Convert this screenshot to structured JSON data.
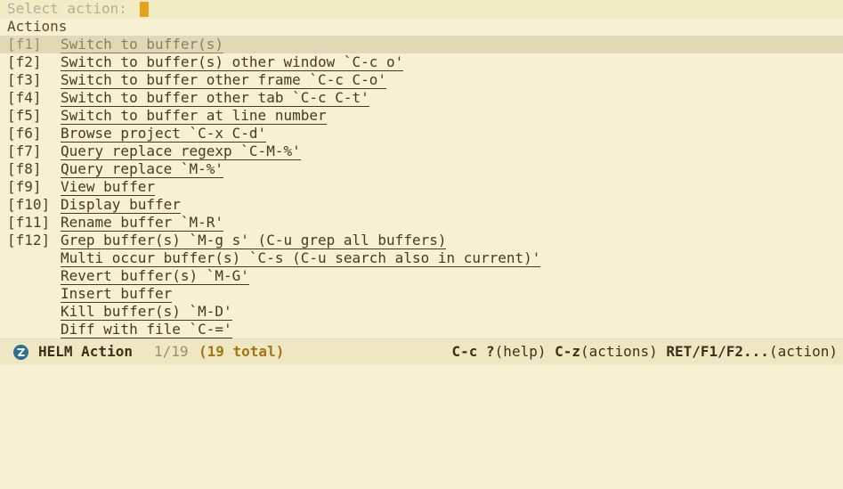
{
  "minibuffer": {
    "prompt": "Select action: "
  },
  "source_header": "Actions",
  "actions": [
    {
      "key": "[f1]",
      "label": "Switch to buffer(s)",
      "selected": true
    },
    {
      "key": "[f2]",
      "label": "Switch to buffer(s) other window `C-c o'"
    },
    {
      "key": "[f3]",
      "label": "Switch to buffer other frame `C-c C-o'"
    },
    {
      "key": "[f4]",
      "label": "Switch to buffer other tab `C-c C-t'"
    },
    {
      "key": "[f5]",
      "label": "Switch to buffer at line number"
    },
    {
      "key": "[f6]",
      "label": "Browse project `C-x C-d'"
    },
    {
      "key": "[f7]",
      "label": "Query replace regexp `C-M-%'"
    },
    {
      "key": "[f8]",
      "label": "Query replace `M-%'"
    },
    {
      "key": "[f9]",
      "label": "View buffer"
    },
    {
      "key": "[f10]",
      "label": "Display buffer"
    },
    {
      "key": "[f11]",
      "label": "Rename buffer `M-R'"
    },
    {
      "key": "[f12]",
      "label": "Grep buffer(s) `M-g s' (C-u grep all buffers)"
    },
    {
      "key": "",
      "label": "Multi occur buffer(s) `C-s (C-u search also in current)'"
    },
    {
      "key": "",
      "label": "Revert buffer(s) `M-G'"
    },
    {
      "key": "",
      "label": "Insert buffer"
    },
    {
      "key": "",
      "label": "Kill buffer(s) `M-D'"
    },
    {
      "key": "",
      "label": "Diff with file `C-='"
    }
  ],
  "modeline": {
    "mode_name": "HELM Action",
    "position": "1/19",
    "total": "(19 total)",
    "help_key1": "C-c ?",
    "help_text1": "(help) ",
    "help_key2": "C-z",
    "help_text2": "(actions) ",
    "help_key3": "RET/F1/F2...",
    "help_text3": "(action)"
  },
  "colors": {
    "background": "#f6f1d3",
    "selection": "#e1d9b6",
    "cursor": "#e8a21a",
    "total": "#a0780f"
  }
}
